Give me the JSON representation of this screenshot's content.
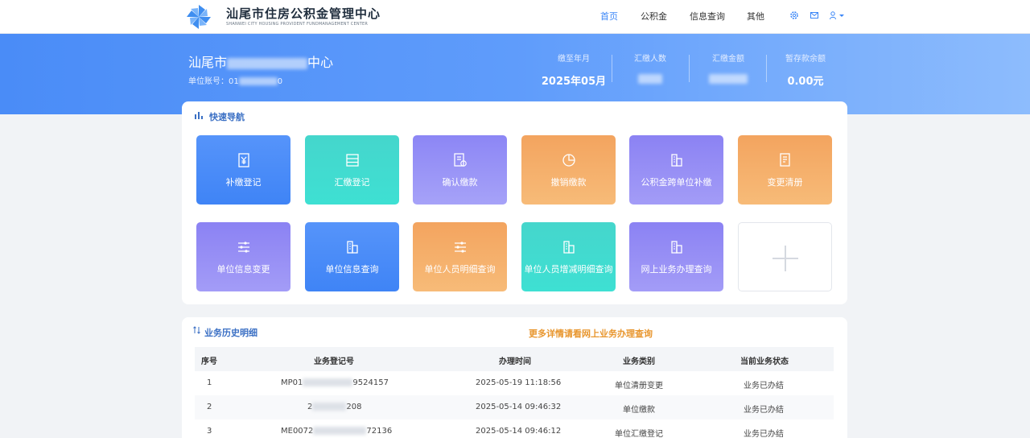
{
  "header": {
    "brand_cn": "汕尾市住房公积金管理中心",
    "brand_en": "SHANWEI CITY HOUSING PROVIDENT FUNDMANAGEMENT CENTER",
    "nav": [
      "首页",
      "公积金",
      "信息查询",
      "其他"
    ],
    "icons": [
      "gear-icon",
      "mail-icon",
      "user-icon"
    ]
  },
  "banner": {
    "org_prefix": "汕尾市",
    "org_suffix": "中心",
    "acct_label": "单位账号：",
    "acct_prefix": "01",
    "acct_suffix": "0",
    "stats": [
      {
        "label": "缴至年月",
        "value": "2025年05月"
      },
      {
        "label": "汇缴人数",
        "value": ""
      },
      {
        "label": "汇缴金额",
        "value": ""
      },
      {
        "label": "暂存款余额",
        "value": "0.00元"
      }
    ]
  },
  "quick_nav": {
    "title": "快速导航",
    "tiles": [
      {
        "label": "补缴登记",
        "icon": "yen-receipt-icon"
      },
      {
        "label": "汇缴登记",
        "icon": "list-box-icon"
      },
      {
        "label": "确认缴款",
        "icon": "doc-check-icon"
      },
      {
        "label": "撤销缴款",
        "icon": "pie-icon"
      },
      {
        "label": "公积金跨单位补缴",
        "icon": "building-icon"
      },
      {
        "label": "变更清册",
        "icon": "doc-icon"
      },
      {
        "label": "单位信息变更",
        "icon": "sliders-icon"
      },
      {
        "label": "单位信息查询",
        "icon": "building-icon"
      },
      {
        "label": "单位人员明细查询",
        "icon": "sliders-icon"
      },
      {
        "label": "单位人员增减明细查询",
        "icon": "building-icon"
      },
      {
        "label": "网上业务办理查询",
        "icon": "building-icon"
      },
      {
        "label": "",
        "icon": "plus-icon"
      }
    ]
  },
  "history": {
    "title": "业务历史明细",
    "more_link": "更多详情请看网上业务办理查询",
    "columns": [
      "序号",
      "业务登记号",
      "办理时间",
      "业务类别",
      "当前业务状态"
    ],
    "rows": [
      {
        "no": "1",
        "reg_prefix": "MP01",
        "reg_suffix": "9524157",
        "time": "2025-05-19 11:18:56",
        "type": "单位清册变更",
        "status": "业务已办结"
      },
      {
        "no": "2",
        "reg_prefix": "2",
        "reg_suffix": "208",
        "time": "2025-05-14 09:46:32",
        "type": "单位缴款",
        "status": "业务已办结"
      },
      {
        "no": "3",
        "reg_prefix": "ME0072",
        "reg_suffix": "72136",
        "time": "2025-05-14 09:46:12",
        "type": "单位汇缴登记",
        "status": "业务已办结"
      }
    ]
  },
  "colors": {
    "accent": "#3a86f7",
    "banner": "#5f9cfb",
    "link": "#e8962e"
  }
}
